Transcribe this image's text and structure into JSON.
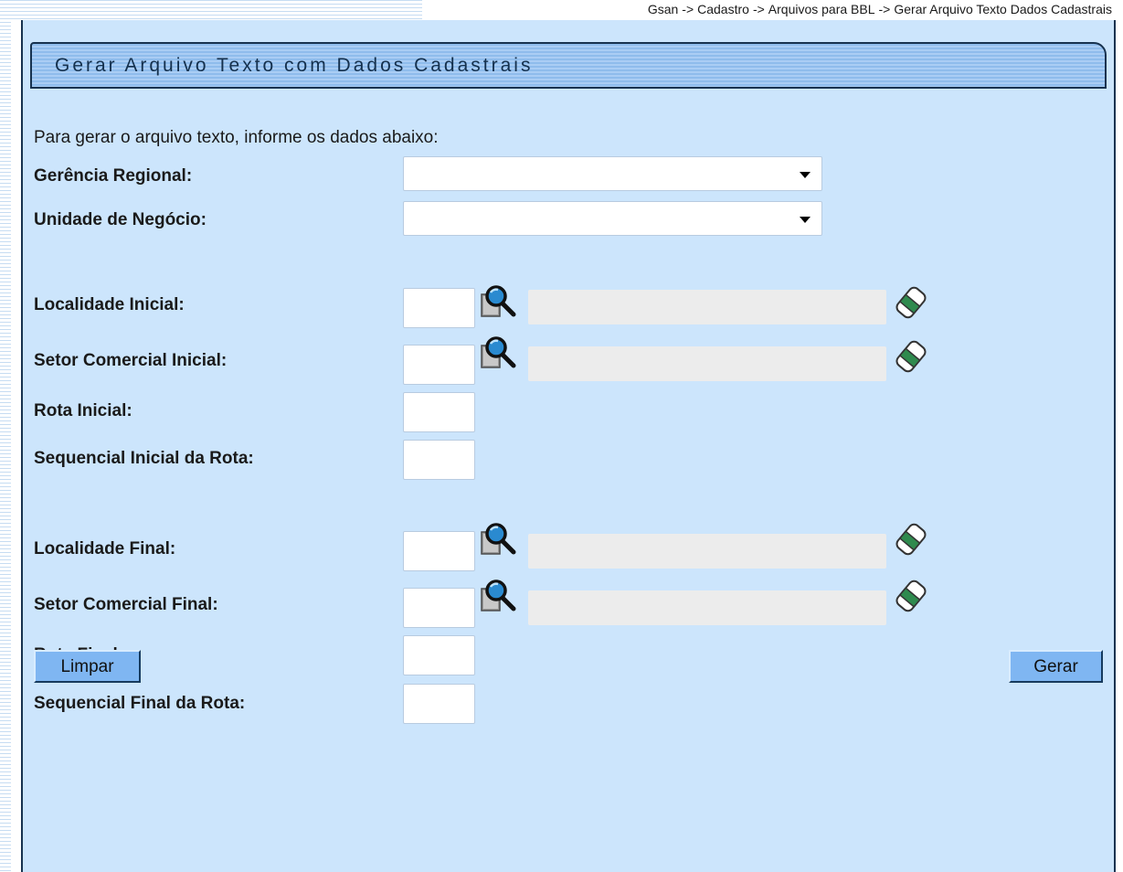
{
  "breadcrumb": [
    "Gsan",
    "Cadastro",
    "Arquivos para BBL",
    "Gerar Arquivo Texto Dados Cadastrais"
  ],
  "breadcrumb_separator": "->",
  "title": "Gerar Arquivo Texto com Dados Cadastrais",
  "intro": "Para gerar o arquivo texto, informe os dados abaixo:",
  "fields": {
    "gerencia_regional": {
      "label": "Gerência Regional:",
      "value": ""
    },
    "unidade_negocio": {
      "label": "Unidade de Negócio:",
      "value": ""
    },
    "localidade_inicial": {
      "label": "Localidade Inicial:",
      "value": "",
      "description": ""
    },
    "setor_comercial_inicial": {
      "label": "Setor Comercial Inicial:",
      "value": "",
      "description": ""
    },
    "rota_inicial": {
      "label": "Rota Inicial:",
      "value": ""
    },
    "sequencial_inicial_rota": {
      "label": "Sequencial Inicial da Rota:",
      "value": ""
    },
    "localidade_final": {
      "label": "Localidade Final:",
      "value": "",
      "description": ""
    },
    "setor_comercial_final": {
      "label": "Setor Comercial Final:",
      "value": "",
      "description": ""
    },
    "rota_final": {
      "label": "Rota Final:",
      "value": ""
    },
    "sequencial_final_rota": {
      "label": "Sequencial Final da Rota:",
      "value": ""
    }
  },
  "buttons": {
    "limpar": "Limpar",
    "gerar": "Gerar"
  },
  "icons": {
    "search": "search-icon",
    "clear": "eraser-icon"
  },
  "colors": {
    "panel_bg": "#cce5fc",
    "title_bar": "#8fbcec",
    "button_bg": "#7fb6f2",
    "dark_border": "#17324f",
    "readonly_field": "#ececec"
  }
}
